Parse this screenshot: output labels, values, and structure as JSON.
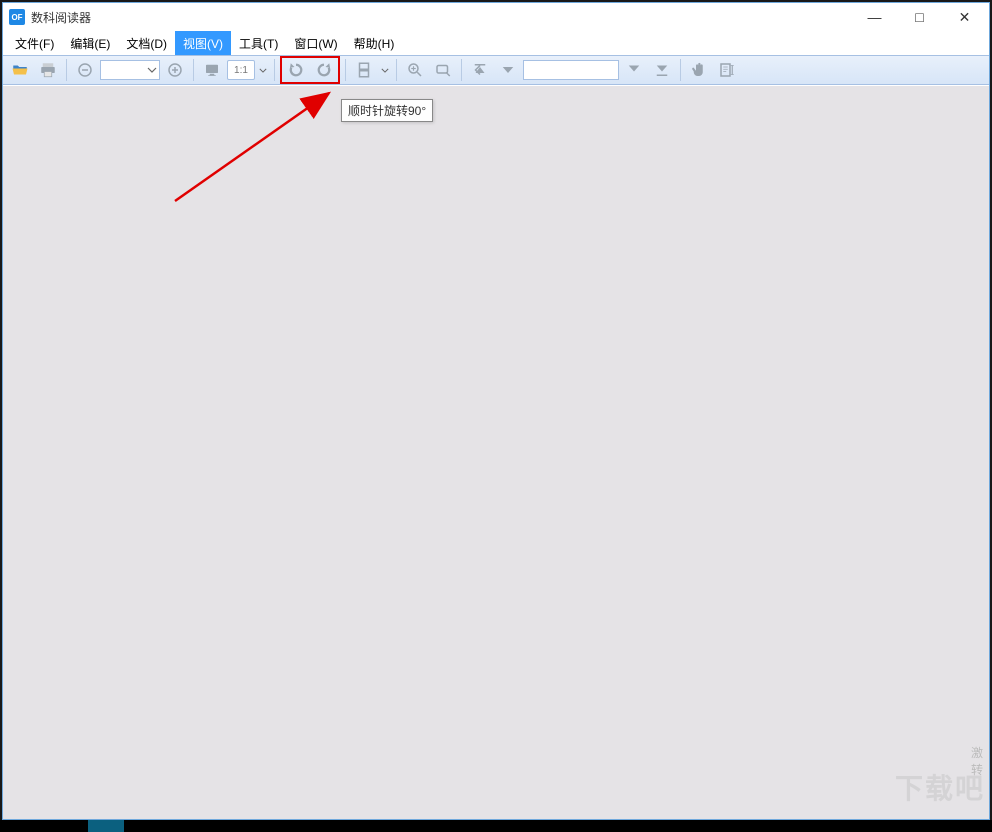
{
  "app": {
    "icon_text": "OF",
    "title": "数科阅读器"
  },
  "window_controls": {
    "minimize": "—",
    "maximize": "□",
    "close": "✕"
  },
  "menu": {
    "file": "文件(F)",
    "edit": "编辑(E)",
    "doc": "文档(D)",
    "view": "视图(V)",
    "tools": "工具(T)",
    "window": "窗口(W)",
    "help": "帮助(H)",
    "selected": "view"
  },
  "toolbar": {
    "zoom_value": "",
    "ratio_label": "1:1",
    "page_value": ""
  },
  "tooltip": {
    "text": "顺时针旋转90°"
  },
  "watermark": {
    "line1": "激",
    "line2": "转",
    "brand": "下载吧"
  }
}
